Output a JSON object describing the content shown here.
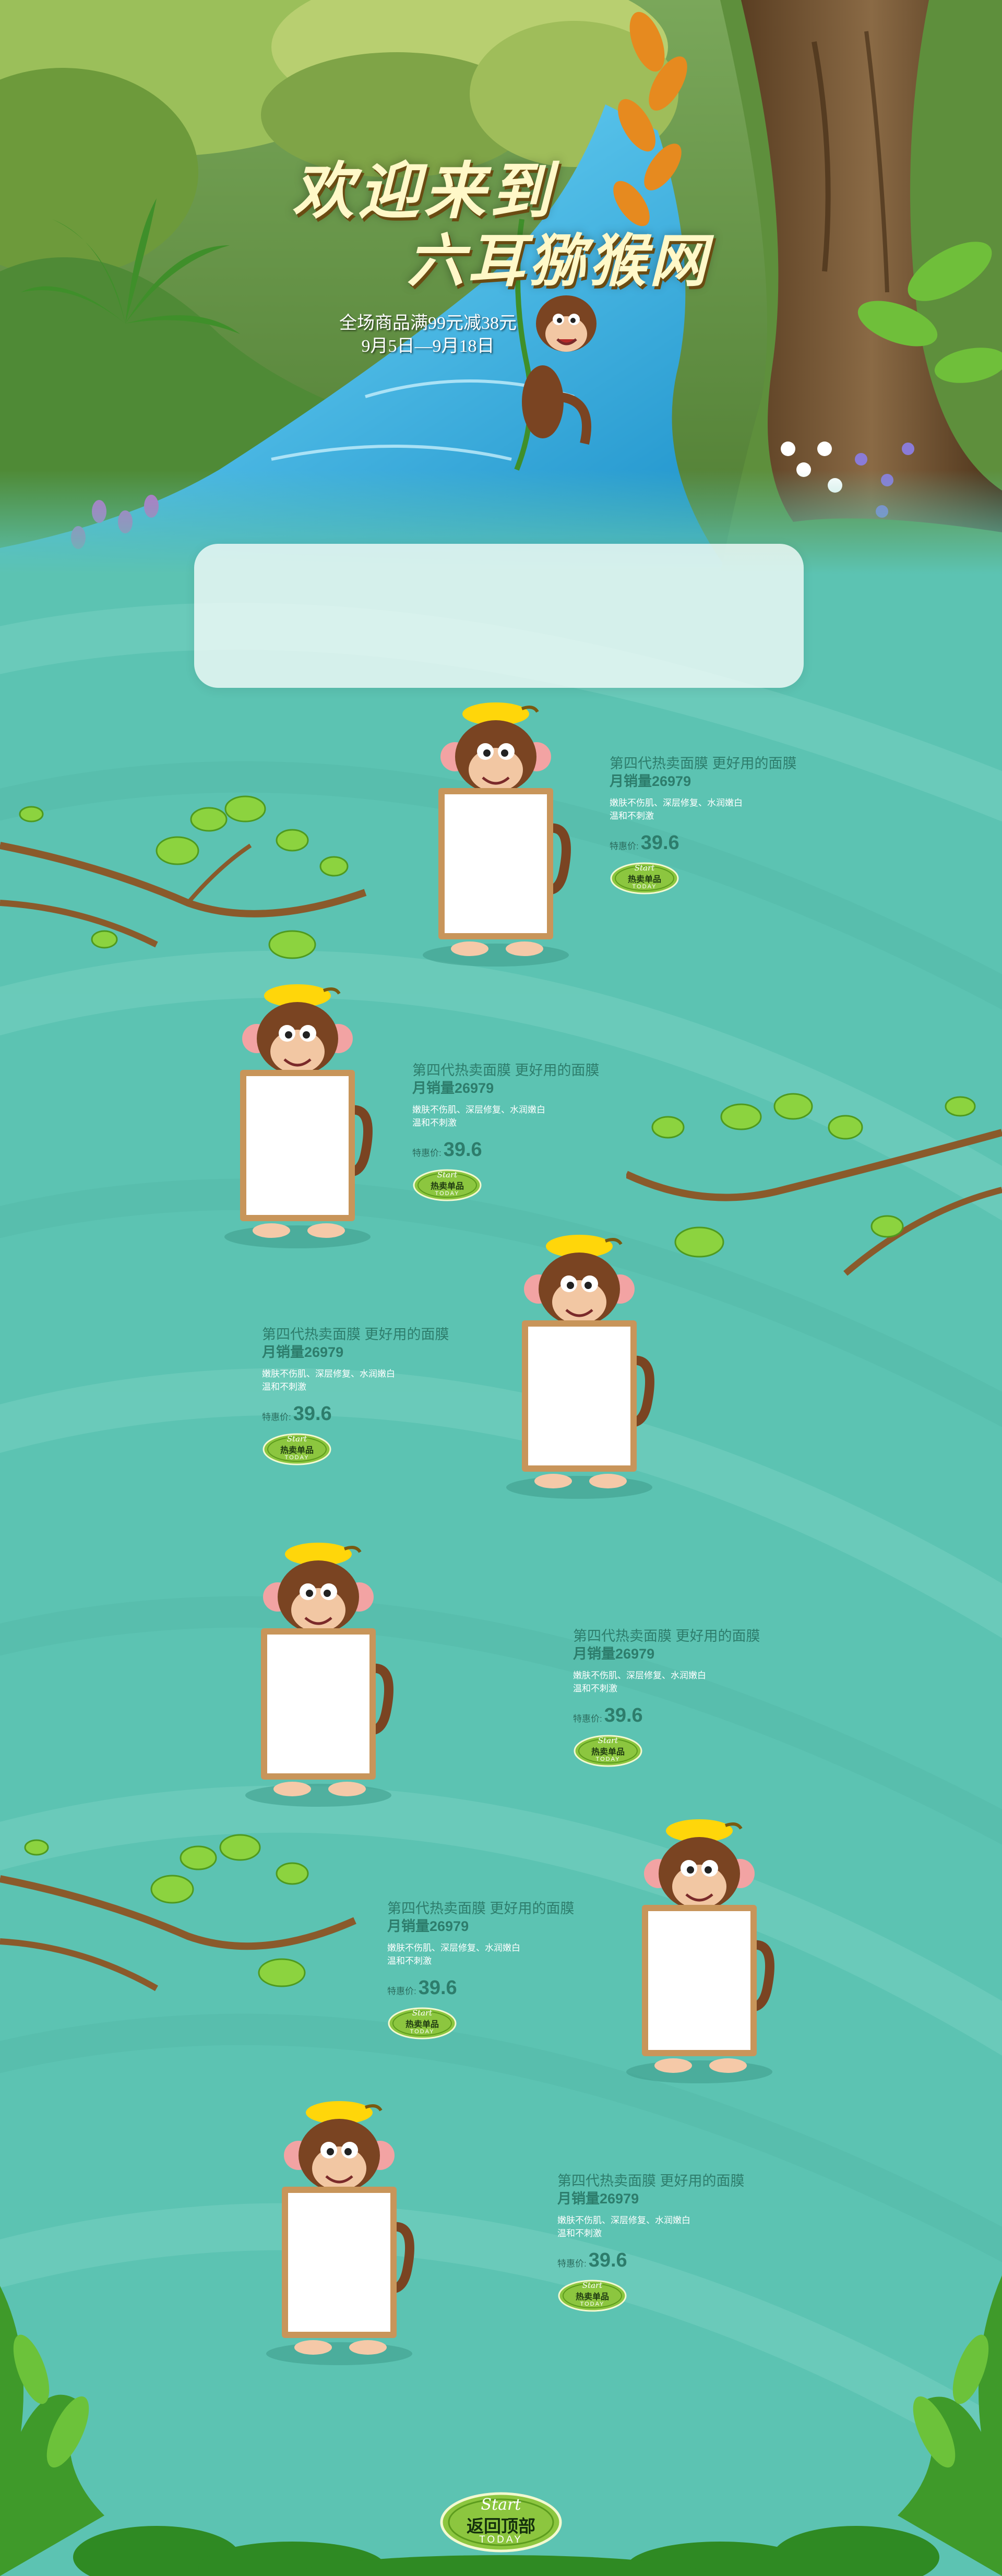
{
  "hero": {
    "title_line1": "欢迎来到",
    "title_line2": "六耳猕猴网",
    "promo_line1": "全场商品满99元减38元",
    "promo_line2": "9月5日—9月18日"
  },
  "products": [
    {
      "title": "第四代热卖面膜 更好用的面膜",
      "sales": "月销量26979",
      "desc_line1": "嫩肤不伤肌、深层修复、水润嫩白",
      "desc_line2": "温和不刺激",
      "price_label": "特惠价:",
      "price": "39.6",
      "badge_start": "Start",
      "badge_label": "热卖单品",
      "badge_today": "TODAY"
    },
    {
      "title": "第四代热卖面膜 更好用的面膜",
      "sales": "月销量26979",
      "desc_line1": "嫩肤不伤肌、深层修复、水润嫩白",
      "desc_line2": "温和不刺激",
      "price_label": "特惠价:",
      "price": "39.6",
      "badge_start": "Start",
      "badge_label": "热卖单品",
      "badge_today": "TODAY"
    },
    {
      "title": "第四代热卖面膜 更好用的面膜",
      "sales": "月销量26979",
      "desc_line1": "嫩肤不伤肌、深层修复、水润嫩白",
      "desc_line2": "温和不刺激",
      "price_label": "特惠价:",
      "price": "39.6",
      "badge_start": "Start",
      "badge_label": "热卖单品",
      "badge_today": "TODAY"
    },
    {
      "title": "第四代热卖面膜 更好用的面膜",
      "sales": "月销量26979",
      "desc_line1": "嫩肤不伤肌、深层修复、水润嫩白",
      "desc_line2": "温和不刺激",
      "price_label": "特惠价:",
      "price": "39.6",
      "badge_start": "Start",
      "badge_label": "热卖单品",
      "badge_today": "TODAY"
    },
    {
      "title": "第四代热卖面膜 更好用的面膜",
      "sales": "月销量26979",
      "desc_line1": "嫩肤不伤肌、深层修复、水润嫩白",
      "desc_line2": "温和不刺激",
      "price_label": "特惠价:",
      "price": "39.6",
      "badge_start": "Start",
      "badge_label": "热卖单品",
      "badge_today": "TODAY"
    },
    {
      "title": "第四代热卖面膜 更好用的面膜",
      "sales": "月销量26979",
      "desc_line1": "嫩肤不伤肌、深层修复、水润嫩白",
      "desc_line2": "温和不刺激",
      "price_label": "特惠价:",
      "price": "39.6",
      "badge_start": "Start",
      "badge_label": "热卖单品",
      "badge_today": "TODAY"
    }
  ],
  "back_to_top": {
    "start": "Start",
    "label": "返回顶部",
    "today": "TODAY"
  },
  "colors": {
    "background_teal": "#5cc3b2",
    "text_teal": "#2d7d6c",
    "badge_green": "#8cc63f",
    "banana_yellow": "#ffd60a",
    "monkey_brown": "#6b3a1f"
  },
  "icons": {
    "monkey": "monkey-holding-sign-icon",
    "banana": "banana-icon",
    "badge": "hot-item-badge-icon",
    "branch": "leafy-branch-icon"
  }
}
